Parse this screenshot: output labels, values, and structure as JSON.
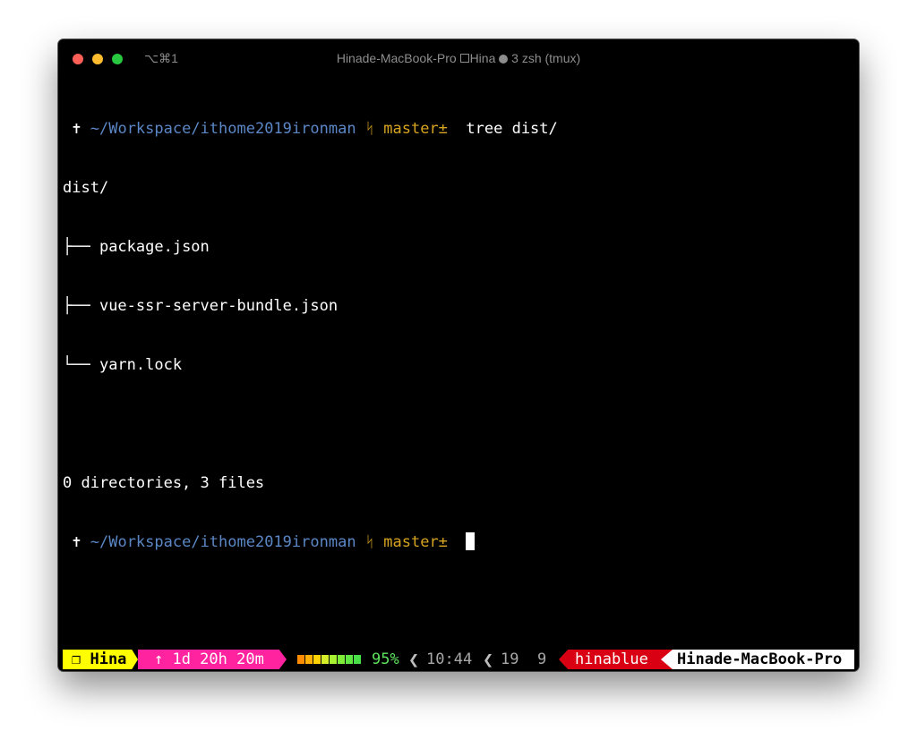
{
  "window": {
    "shortcut": "⌥⌘1",
    "title_host": "Hinade-MacBook-Pro",
    "title_session": "Hina",
    "title_pane": "3 zsh (tmux)"
  },
  "terminal": {
    "prompt1": {
      "symbol": "✝",
      "path": "~/Workspace/ithome2019ironman",
      "branch_icon": "ᛋ",
      "branch": "master±",
      "command": "tree dist/"
    },
    "tree_root": "dist/",
    "tree_items": [
      {
        "prefix": "├── ",
        "name": "package.json"
      },
      {
        "prefix": "├── ",
        "name": "vue-ssr-server-bundle.json"
      },
      {
        "prefix": "└── ",
        "name": "yarn.lock"
      }
    ],
    "summary": "0 directories, 3 files",
    "prompt2": {
      "symbol": "✝",
      "path": "~/Workspace/ithome2019ironman",
      "branch_icon": "ᛋ",
      "branch": "master±"
    }
  },
  "statusbar": {
    "session": "❐ Hina",
    "uptime": "↑ 1d 20h 20m",
    "battery_level": 0.95,
    "battery_colors": [
      "#ff8c00",
      "#ffb000",
      "#ffd200",
      "#d6ee2a",
      "#a8f032",
      "#7fec3a",
      "#60e642",
      "#48df48"
    ],
    "battery_pct": "95%",
    "separator": "❮",
    "time": "10:44",
    "day": "19",
    "month": "9",
    "user": "hinablue",
    "host": "Hinade-MacBook-Pro"
  }
}
